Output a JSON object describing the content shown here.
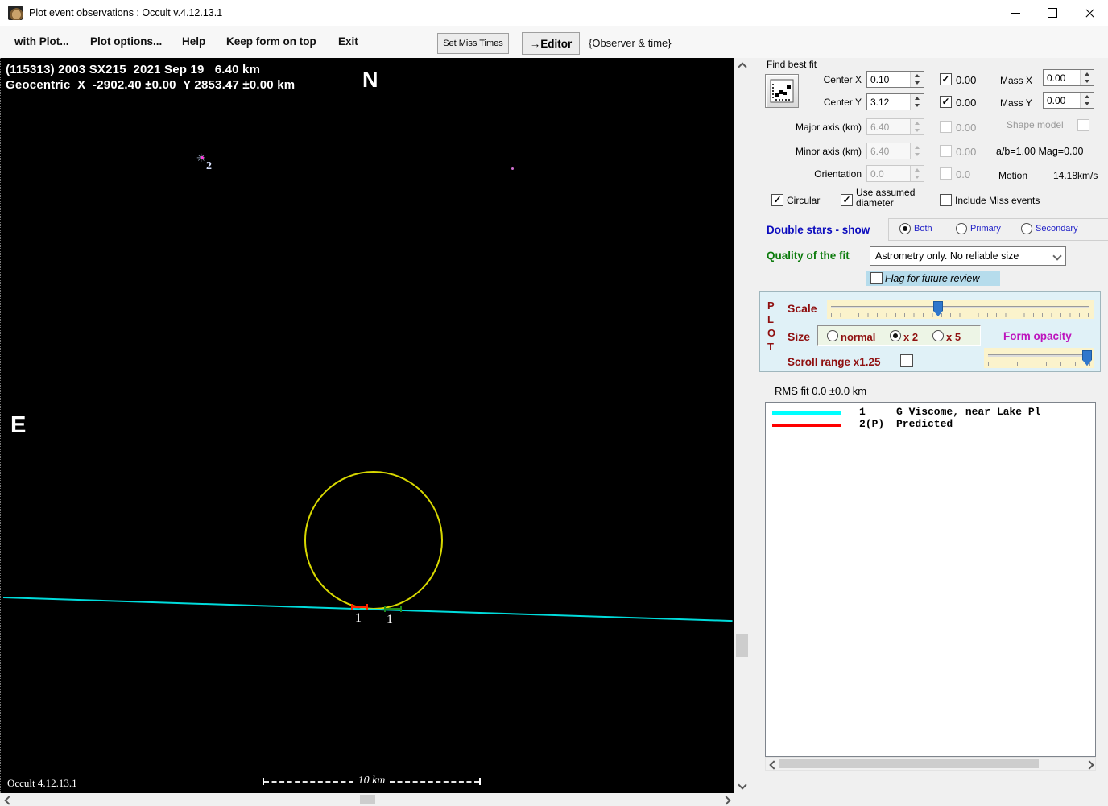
{
  "window": {
    "title": "Plot event observations : Occult v.4.12.13.1"
  },
  "menubar": {
    "items": [
      {
        "label": "with Plot..."
      },
      {
        "label": "Plot options..."
      },
      {
        "label": "Help"
      },
      {
        "label": "Keep form on top"
      },
      {
        "label": "Exit"
      }
    ],
    "set_miss_times_button": "Set Miss Times",
    "editor_button": "→Editor",
    "observer_time_label": "{Observer & time}"
  },
  "plot": {
    "header_line1": "(115313) 2003 SX215  2021 Sep 19   6.40 km",
    "header_line2": "Geocentric  X  -2902.40 ±0.00  Y 2853.47 ±0.00 km",
    "north": "N",
    "east": "E",
    "star2_label": "2",
    "chord_labels": [
      "1",
      "1"
    ],
    "scale_bar_label": "10 km",
    "version": "Occult 4.12.13.1",
    "colors": {
      "circle": "#d8d800",
      "chord": "#00dcdc",
      "event1": "#ff2600",
      "event2": "#1f8a1f",
      "star_dot": "#ff3ddd",
      "stray_dot": "#d070d0"
    }
  },
  "fit": {
    "title": "Find best fit",
    "center_x": {
      "label": "Center X",
      "value": "0.10",
      "lock": "0.00"
    },
    "center_y": {
      "label": "Center Y",
      "value": "3.12",
      "lock": "0.00"
    },
    "mass_x": {
      "label": "Mass X",
      "value": "0.00"
    },
    "mass_y": {
      "label": "Mass Y",
      "value": "0.00"
    },
    "major": {
      "label": "Major axis (km)",
      "value": "6.40",
      "lock": "0.00"
    },
    "minor": {
      "label": "Minor axis (km)",
      "value": "6.40",
      "lock": "0.00"
    },
    "orientation": {
      "label": "Orientation",
      "value": "0.0",
      "lock": "0.0"
    },
    "shape_model_label": "Shape model",
    "ab_mag": "a/b=1.00 Mag=0.00",
    "motion_label": "Motion",
    "motion_value": "14.18km/s",
    "circular_label": "Circular",
    "use_assumed_label": "Use assumed diameter",
    "include_miss_label": "Include Miss events"
  },
  "double_stars": {
    "label": "Double stars - show",
    "options": [
      "Both",
      "Primary",
      "Secondary"
    ],
    "selected": "Both"
  },
  "quality": {
    "label": "Quality of the fit",
    "value": "Astrometry only. No reliable size",
    "flag_label": "Flag for future review"
  },
  "plot_controls": {
    "letters": [
      "P",
      "L",
      "O",
      "T"
    ],
    "scale_label": "Scale",
    "size_label": "Size",
    "size_options": [
      "normal",
      "x 2",
      "x 5"
    ],
    "size_selected": "x 2",
    "form_opacity_label": "Form opacity",
    "scroll_range_label": "Scroll range x1.25"
  },
  "rms_label": "RMS fit 0.0 ±0.0 km",
  "legend": {
    "rows": [
      {
        "num": "1",
        "name": "G Viscome, near Lake Pl",
        "color": "#00ffff"
      },
      {
        "num": "2(P)",
        "name": "Predicted",
        "color": "#ff0000"
      }
    ]
  }
}
